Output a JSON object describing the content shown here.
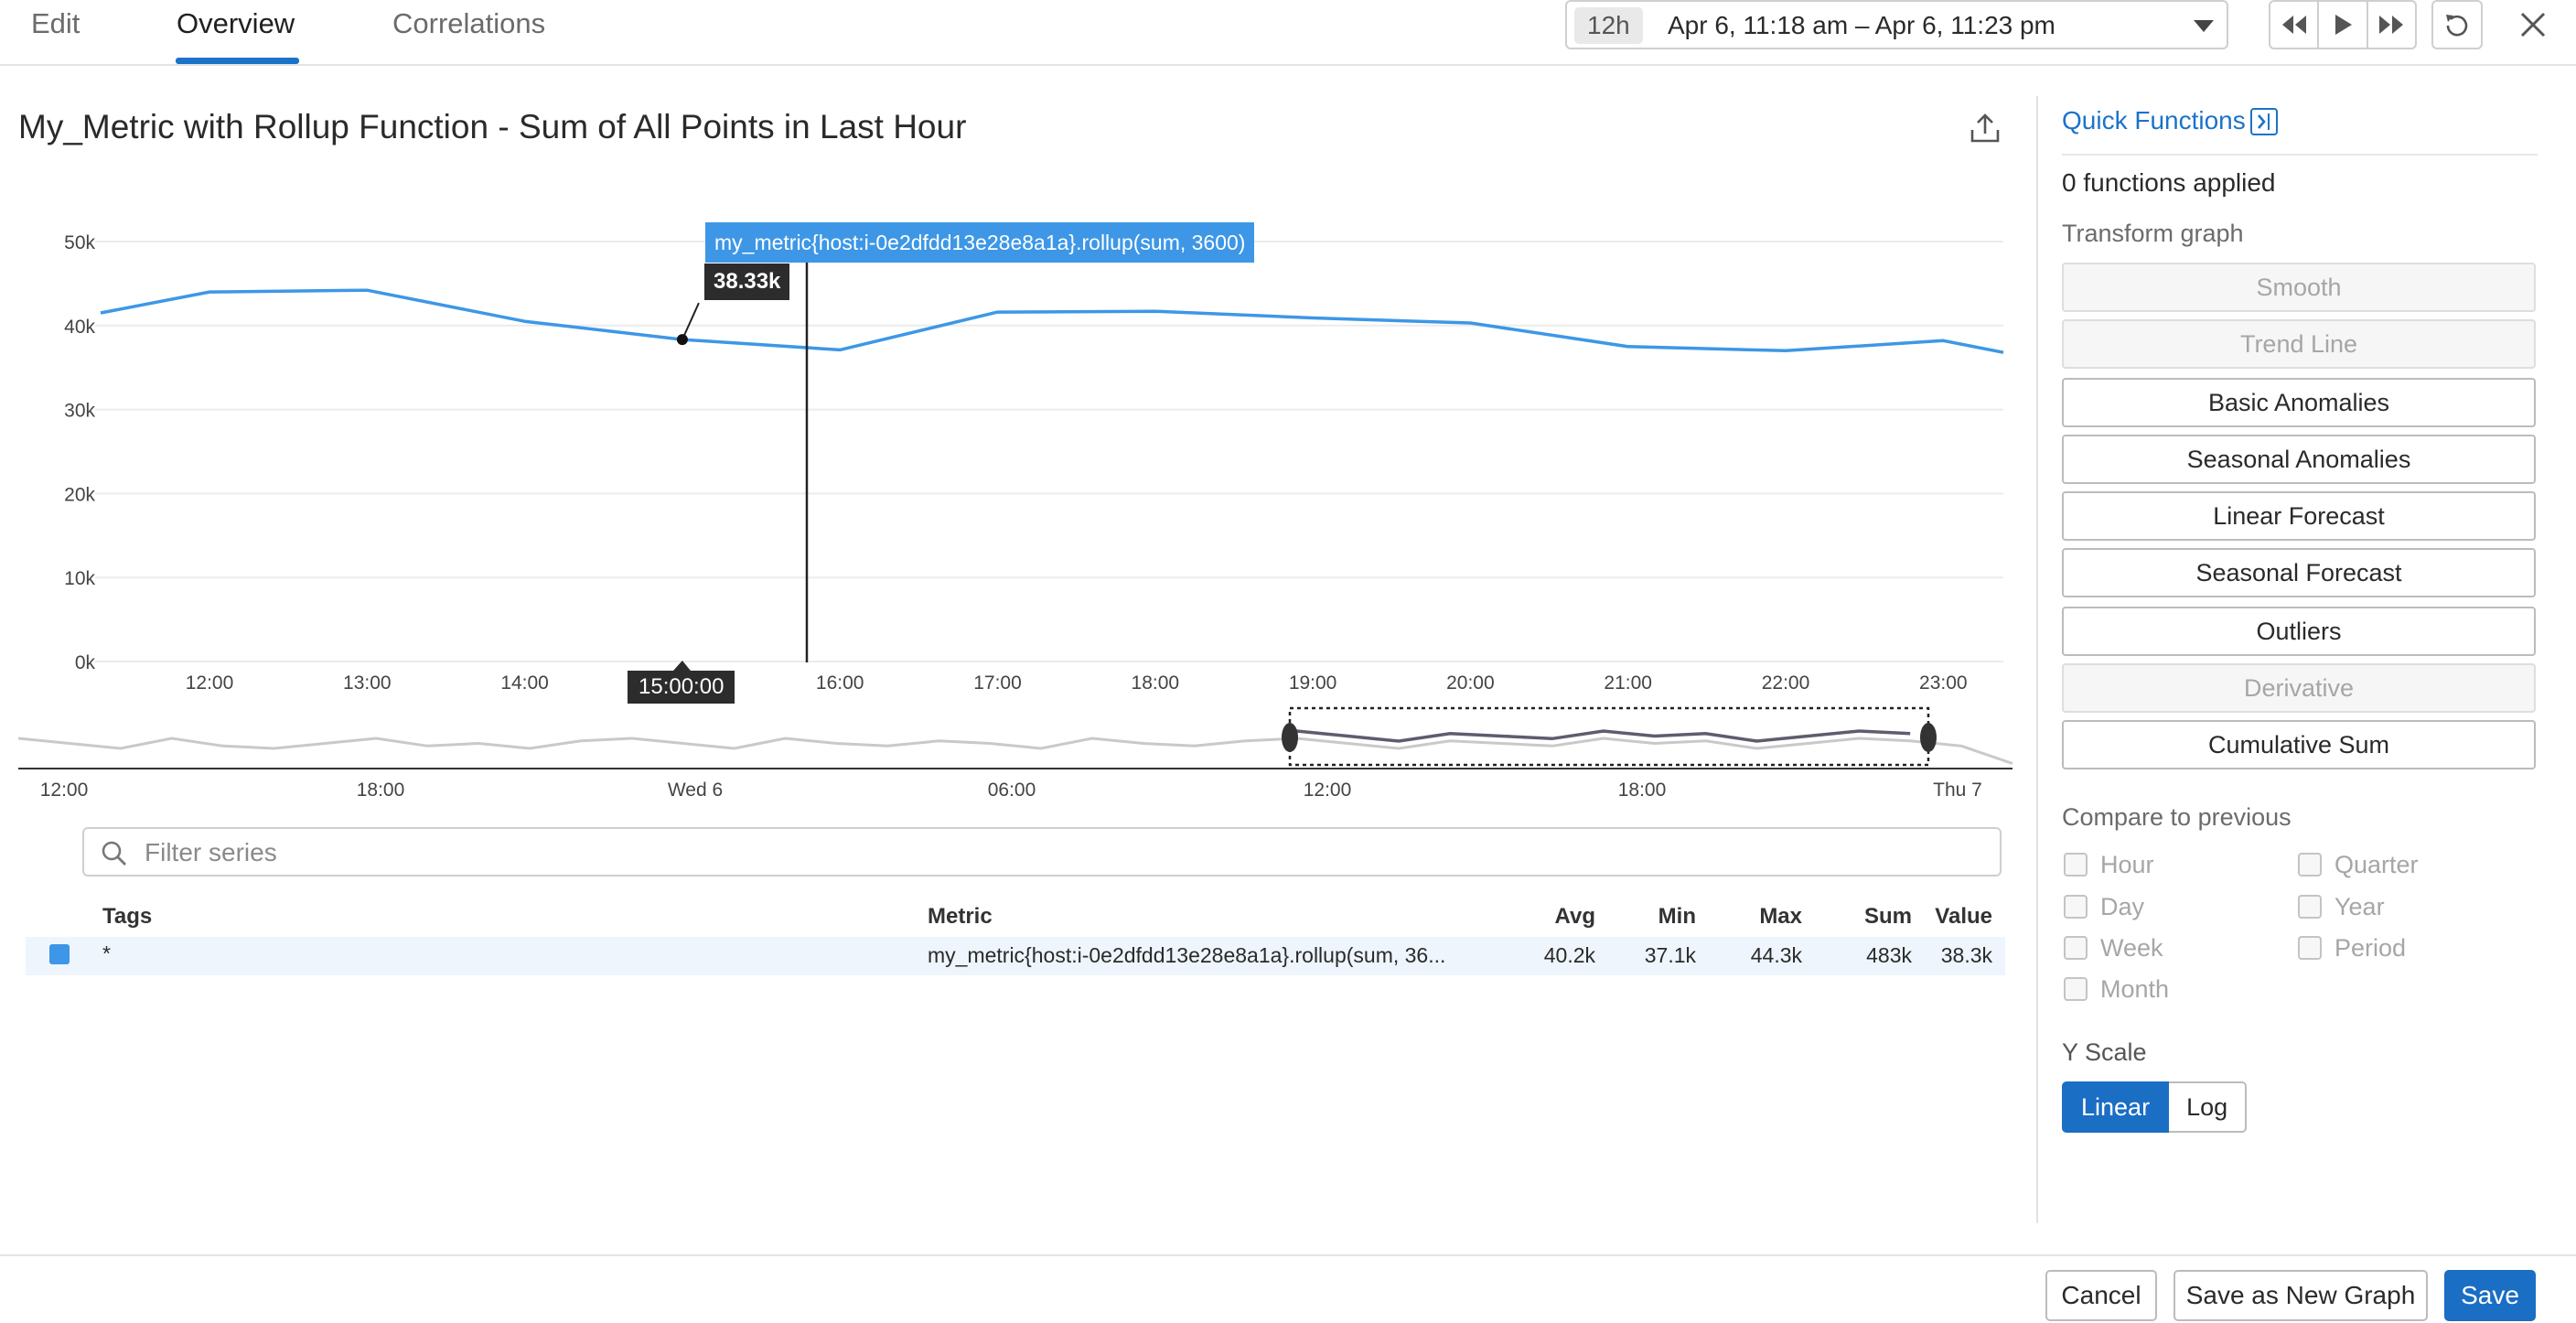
{
  "tabs": [
    {
      "label": "Edit"
    },
    {
      "label": "Overview",
      "active": true
    },
    {
      "label": "Correlations"
    }
  ],
  "timepicker": {
    "pill": "12h",
    "range": "Apr 6, 11:18 am – Apr 6, 11:23 pm"
  },
  "graph": {
    "title": "My_Metric with Rollup Function - Sum of All Points in Last Hour"
  },
  "tooltip": {
    "series": "my_metric{host:i-0e2dfdd13e28e8a1a}.rollup(sum, 3600)",
    "value": "38.33k",
    "time": "15:00:00"
  },
  "chart_data": {
    "type": "line",
    "series": [
      {
        "name": "my_metric{host:i-0e2dfdd13e28e8a1a}.rollup(sum, 3600)",
        "color": "#3d97e6",
        "x": [
          "11:18",
          "12:00",
          "13:00",
          "14:00",
          "15:00",
          "16:00",
          "17:00",
          "18:00",
          "19:00",
          "20:00",
          "21:00",
          "22:00",
          "23:00",
          "23:23"
        ],
        "values": [
          41.5,
          44.0,
          44.2,
          40.5,
          38.33,
          37.1,
          41.6,
          41.7,
          40.9,
          40.3,
          37.5,
          37.0,
          38.2,
          36.8
        ]
      }
    ],
    "y_ticks": [
      "50k",
      "40k",
      "30k",
      "20k",
      "10k",
      "0k"
    ],
    "y_tick_values": [
      50,
      40,
      30,
      20,
      10,
      0
    ],
    "x_ticks": [
      "12:00",
      "13:00",
      "14:00",
      "15:00",
      "16:00",
      "17:00",
      "18:00",
      "19:00",
      "20:00",
      "21:00",
      "22:00",
      "23:00"
    ],
    "ylim": [
      0,
      50
    ],
    "grid": true,
    "cursor_at": "15:00"
  },
  "overview_chart": {
    "x_ticks": [
      "12:00",
      "18:00",
      "Wed 6",
      "06:00",
      "12:00",
      "18:00",
      "Thu 7"
    ],
    "values": [
      0.6,
      0.5,
      0.4,
      0.6,
      0.45,
      0.4,
      0.5,
      0.6,
      0.45,
      0.5,
      0.4,
      0.55,
      0.6,
      0.5,
      0.4,
      0.6,
      0.5,
      0.45,
      0.55,
      0.5,
      0.4,
      0.6,
      0.5,
      0.45,
      0.55,
      0.6,
      0.5,
      0.4,
      0.55,
      0.5,
      0.45,
      0.6,
      0.5,
      0.55,
      0.4,
      0.5,
      0.6,
      0.55,
      0.45,
      0.1
    ],
    "window": "19:00 to 23:00 Apr 6"
  },
  "filter": {
    "placeholder": "Filter series",
    "value": ""
  },
  "table": {
    "headers": {
      "tags": "Tags",
      "metric": "Metric",
      "avg": "Avg",
      "min": "Min",
      "max": "Max",
      "sum": "Sum",
      "value": "Value"
    },
    "rows": [
      {
        "color": "#3d97e6",
        "tags": "*",
        "metric": "my_metric{host:i-0e2dfdd13e28e8a1a}.rollup(sum, 36...",
        "avg": "40.2k",
        "min": "37.1k",
        "max": "44.3k",
        "sum": "483k",
        "value": "38.3k"
      }
    ]
  },
  "panel": {
    "title": "Quick Functions",
    "applied": "0 functions applied",
    "transform_label": "Transform graph",
    "functions": [
      {
        "label": "Smooth",
        "disabled": true
      },
      {
        "label": "Trend Line",
        "disabled": true
      },
      {
        "label": "Basic Anomalies",
        "disabled": false
      },
      {
        "label": "Seasonal Anomalies",
        "disabled": false
      },
      {
        "label": "Linear Forecast",
        "disabled": false
      },
      {
        "label": "Seasonal Forecast",
        "disabled": false
      },
      {
        "label": "Outliers",
        "disabled": false
      },
      {
        "label": "Derivative",
        "disabled": true
      },
      {
        "label": "Cumulative Sum",
        "disabled": false
      }
    ],
    "compare_label": "Compare to previous",
    "compare": {
      "hour": "Hour",
      "quarter": "Quarter",
      "day": "Day",
      "year": "Year",
      "week": "Week",
      "period": "Period",
      "month": "Month"
    },
    "yscale_label": "Y Scale",
    "yscale": {
      "linear": "Linear",
      "log": "Log",
      "selected": "Linear"
    }
  },
  "footer": {
    "cancel": "Cancel",
    "save_new": "Save as New Graph",
    "save": "Save"
  }
}
